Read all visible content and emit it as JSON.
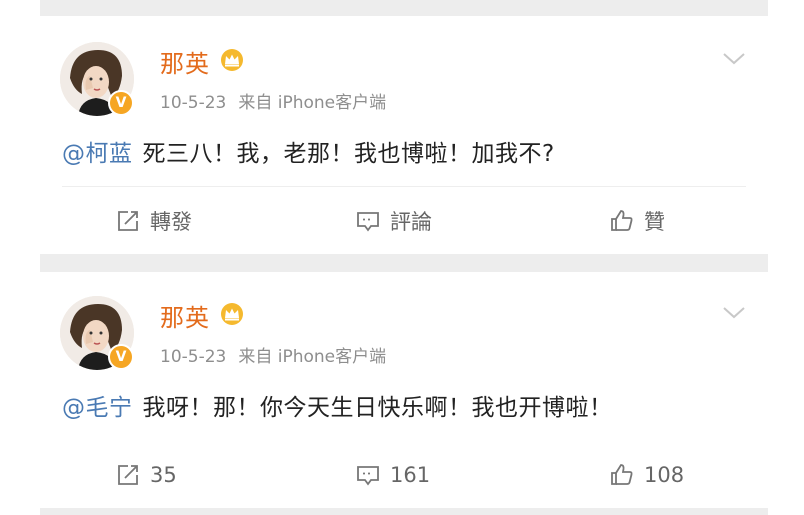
{
  "posts": [
    {
      "author": "那英",
      "time": "10-5-23",
      "source": "来自 iPhone客户端",
      "mention": "@柯蓝",
      "text": "死三八！我，老那！我也博啦！加我不?",
      "actions": {
        "repost": "轉發",
        "comment": "評論",
        "like": "贊"
      }
    },
    {
      "author": "那英",
      "time": "10-5-23",
      "source": "来自 iPhone客户端",
      "mention": "@毛宁",
      "text": "我呀！那！你今天生日快乐啊！我也开博啦！",
      "actions": {
        "repost": "35",
        "comment": "161",
        "like": "108"
      }
    }
  ],
  "colors": {
    "name": "#e36b1c",
    "mention": "#4a7ab3",
    "verified_badge": "#f6a623",
    "separator": "#ededed"
  },
  "icons": {
    "repost": "repost-icon",
    "comment": "comment-icon",
    "like": "thumbs-up-icon",
    "menu": "chevron-down-icon",
    "crown": "crown-icon",
    "verified": "verified-badge-icon"
  }
}
